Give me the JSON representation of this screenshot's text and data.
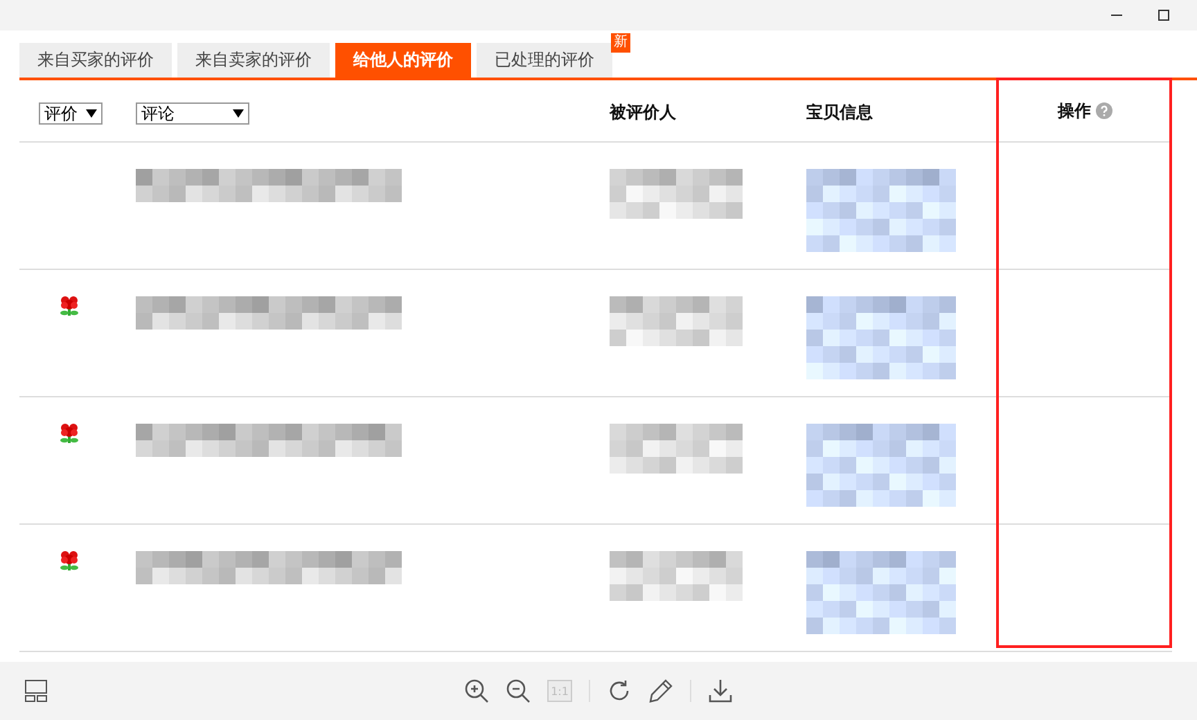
{
  "window": {
    "controls": [
      {
        "kind": "minimize"
      },
      {
        "kind": "maximize"
      }
    ]
  },
  "tabs": [
    {
      "label": "来自买家的评价",
      "selected": false
    },
    {
      "label": "来自卖家的评价",
      "selected": false
    },
    {
      "label": "给他人的评价",
      "selected": true
    },
    {
      "label": "已处理的评价",
      "selected": false,
      "badge": "新"
    }
  ],
  "filters": [
    {
      "value": "评价",
      "kind": "short"
    },
    {
      "value": "评论",
      "kind": "long"
    }
  ],
  "columns": [
    {
      "label": "被评价人"
    },
    {
      "label": "宝贝信息"
    },
    {
      "label": "操作",
      "help": true
    }
  ],
  "rows": [
    {
      "rating_icon": false
    },
    {
      "rating_icon": true
    },
    {
      "rating_icon": true
    },
    {
      "rating_icon": true
    }
  ],
  "annotation": {
    "color": "#ff2020"
  },
  "toolbar": [
    {
      "kind": "layout"
    },
    {
      "kind": "zoom-in"
    },
    {
      "kind": "zoom-out"
    },
    {
      "kind": "actual-size",
      "label": "1:1",
      "disabled": true
    },
    {
      "kind": "rotate"
    },
    {
      "kind": "edit"
    },
    {
      "kind": "download"
    }
  ]
}
